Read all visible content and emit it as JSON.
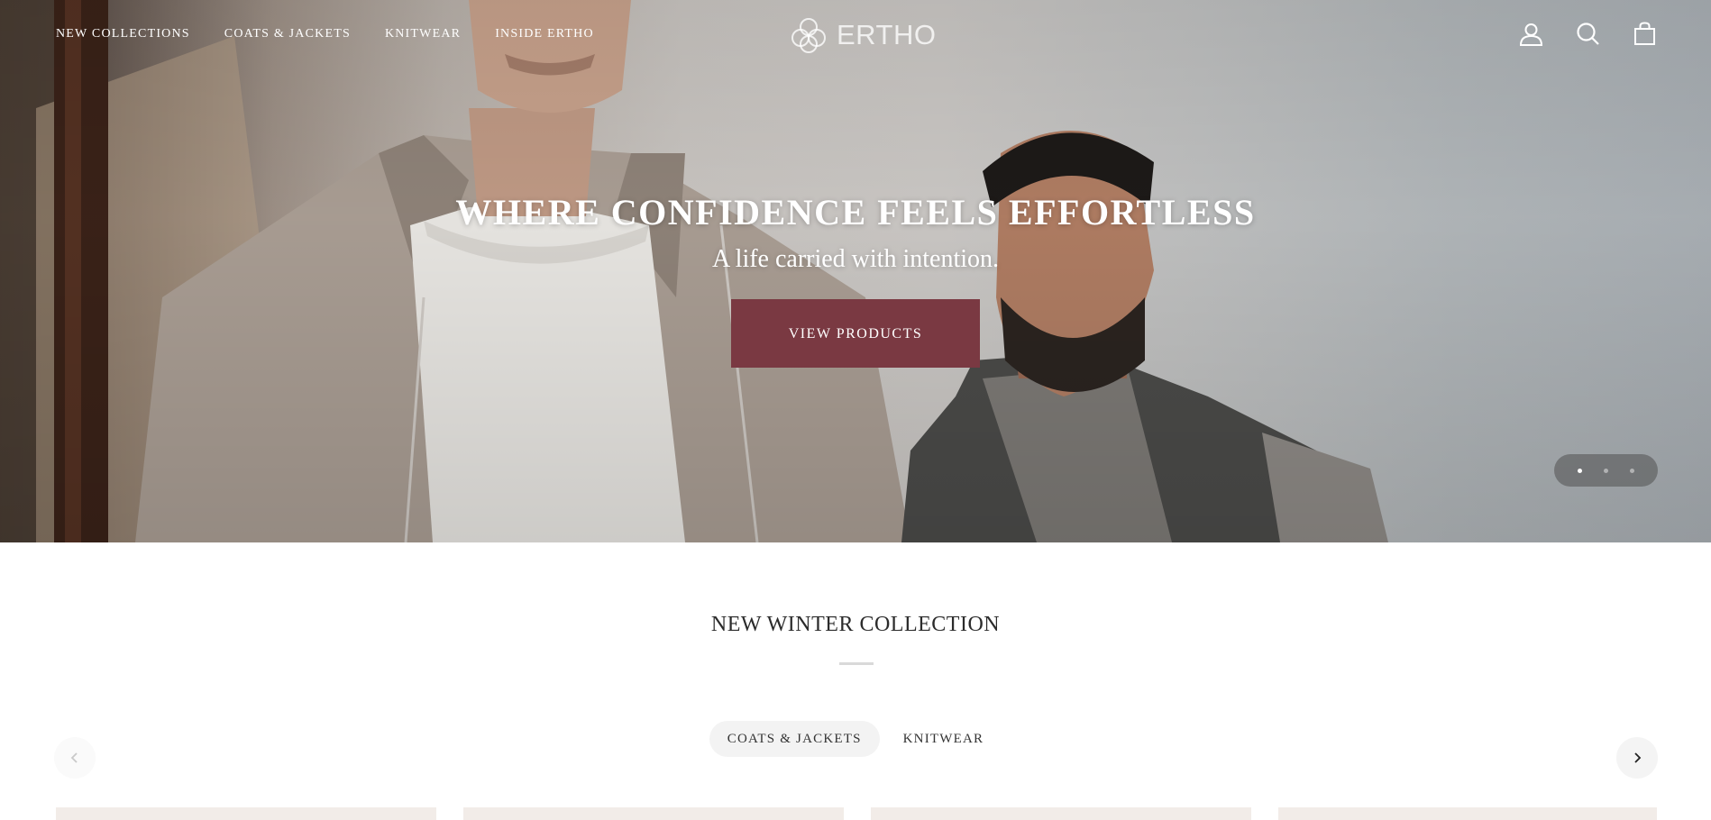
{
  "header": {
    "nav": [
      {
        "label": "NEW COLLECTIONS"
      },
      {
        "label": "COATS & JACKETS"
      },
      {
        "label": "KNITWEAR"
      },
      {
        "label": "INSIDE ERTHO"
      }
    ],
    "logo_text": "ERTHO",
    "icons": [
      "account-icon",
      "search-icon",
      "shopping-bag-icon"
    ]
  },
  "hero": {
    "title": "WHERE CONFIDENCE FEELS EFFORTLESS",
    "subtitle": "A life carried with intention.",
    "cta_label": "VIEW PRODUCTS",
    "slides_total": 3,
    "active_slide": 1
  },
  "collection": {
    "title": "NEW WINTER COLLECTION",
    "tabs": [
      {
        "label": "COATS & JACKETS",
        "active": true
      },
      {
        "label": "KNITWEAR",
        "active": false
      }
    ]
  },
  "colors": {
    "accent": "#7a3942",
    "text": "#2b2b2b",
    "pill_bg": "#f3f3f3"
  }
}
